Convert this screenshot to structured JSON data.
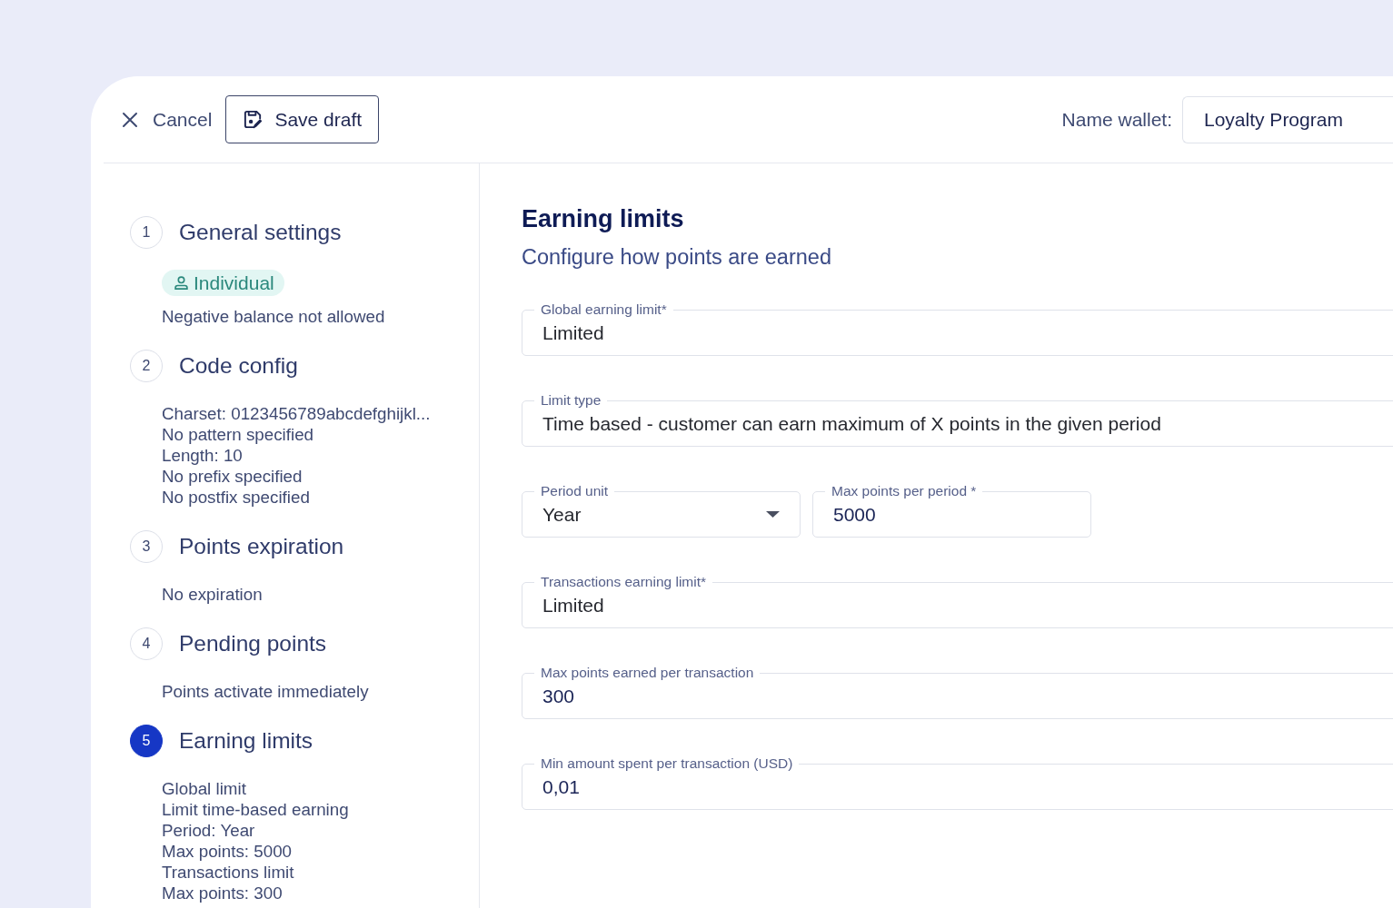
{
  "header": {
    "cancel": "Cancel",
    "save_draft": "Save draft",
    "name_wallet": {
      "label": "Name wallet:",
      "value": "Loyalty Program"
    }
  },
  "steps": [
    {
      "number": "1",
      "title": "General settings",
      "selected": false,
      "badge": "Individual",
      "details": [
        "Negative balance not allowed"
      ]
    },
    {
      "number": "2",
      "title": "Code config",
      "selected": false,
      "details": [
        "Charset: 0123456789abcdefghijkl...",
        "No pattern specified",
        "Length: 10",
        "No prefix specified",
        "No postfix specified"
      ]
    },
    {
      "number": "3",
      "title": "Points expiration",
      "selected": false,
      "details": [
        "No expiration"
      ]
    },
    {
      "number": "4",
      "title": "Pending points",
      "selected": false,
      "details": [
        "Points activate immediately"
      ]
    },
    {
      "number": "5",
      "title": "Earning limits",
      "selected": true,
      "details": [
        "Global limit",
        "Limit time-based earning",
        "Period: Year",
        "Max points: 5000",
        "Transactions limit",
        "Max points: 300"
      ]
    }
  ],
  "form": {
    "title": "Earning limits",
    "subtitle": "Configure how points are earned",
    "rows": [
      {
        "fields": [
          {
            "kind": "select",
            "label": "Global earning limit*",
            "value": "Limited"
          }
        ]
      },
      {
        "fields": [
          {
            "kind": "select",
            "label": "Limit type",
            "value": "Time based - customer can earn maximum of X points in the given period"
          }
        ]
      },
      {
        "fields": [
          {
            "kind": "dropdown",
            "label": "Period unit",
            "value": "Year"
          },
          {
            "kind": "input",
            "label": "Max points per period *",
            "value": "5000"
          }
        ]
      },
      {
        "fields": [
          {
            "kind": "select",
            "label": "Transactions earning limit*",
            "value": "Limited"
          }
        ]
      },
      {
        "fields": [
          {
            "kind": "input",
            "label": "Max points earned per transaction",
            "value": "300"
          }
        ]
      },
      {
        "fields": [
          {
            "kind": "input",
            "label": "Min amount spent per transaction (USD)",
            "value": "0,01"
          }
        ]
      }
    ]
  }
}
